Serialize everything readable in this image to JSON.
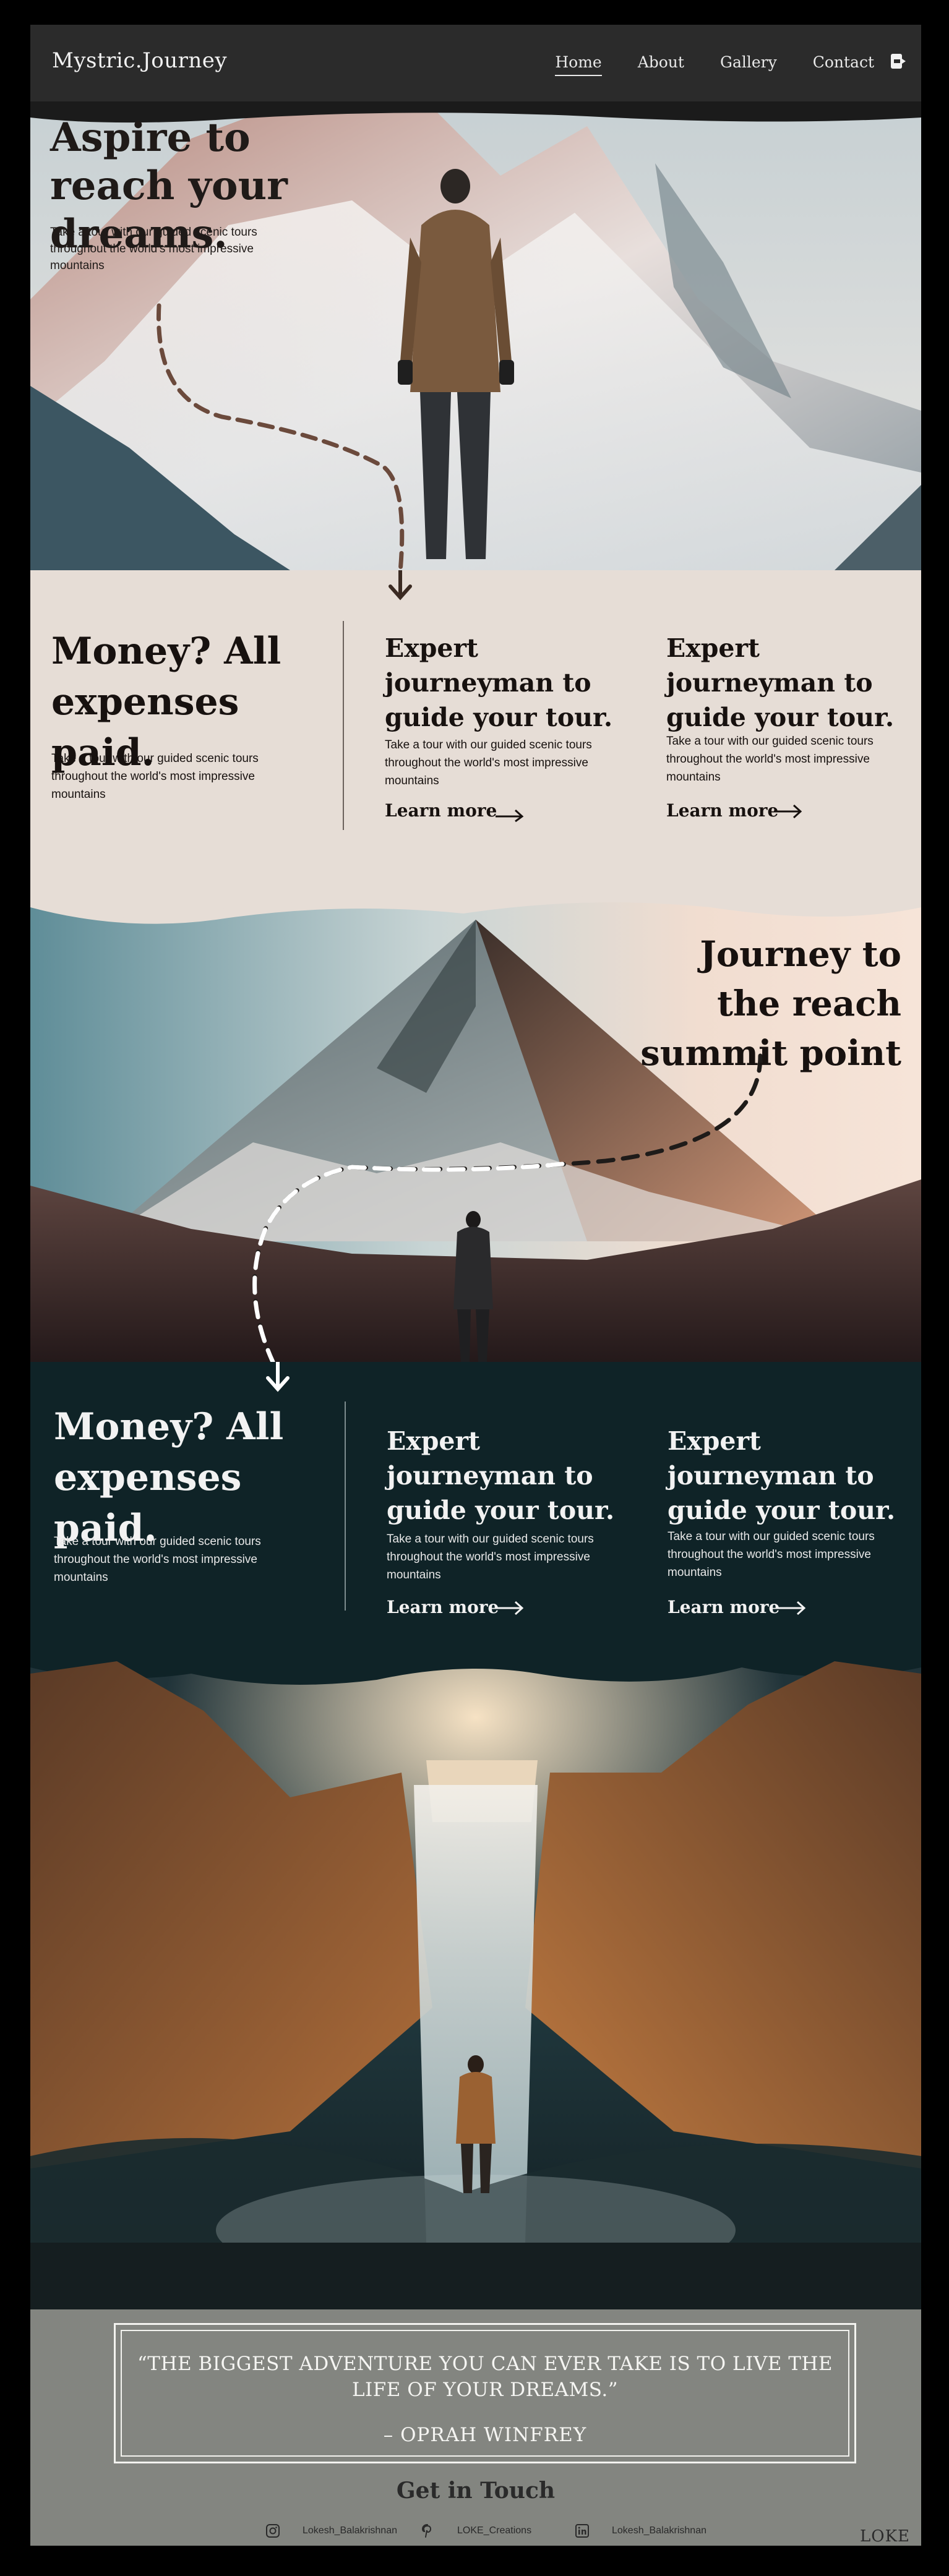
{
  "nav": {
    "brand": "Mystric.Journey",
    "links": [
      "Home",
      "About",
      "Gallery",
      "Contact"
    ],
    "active_link": "Home",
    "icon": "logout-icon"
  },
  "hero": {
    "title": "Aspire to reach your dreams.",
    "subtitle": "Take a tour with our guided scenic tours throughout the world's most impressive mountains"
  },
  "section_light": {
    "main_title": "Money? All expenses paid.",
    "main_text": "Take a tour with our guided scenic tours throughout the world's most impressive mountains",
    "features": [
      {
        "title": "Expert journeyman to guide your tour.",
        "text": "Take a tour with our guided scenic tours throughout the world's most impressive mountains",
        "link": "Learn more"
      },
      {
        "title": "Expert journeyman to guide your tour.",
        "text": "Take a tour with our guided scenic tours throughout the world's most impressive mountains",
        "link": "Learn more"
      }
    ]
  },
  "pyramid": {
    "title": "Journey to the reach summit point"
  },
  "section_dark": {
    "main_title": "Money? All expenses paid.",
    "main_text": "Take a tour with our guided scenic tours throughout the world's most impressive mountains",
    "features": [
      {
        "title": "Expert journeyman to guide your tour.",
        "text": "Take a tour with our guided scenic tours throughout the world's most impressive mountains",
        "link": "Learn more"
      },
      {
        "title": "Expert journeyman to guide your tour.",
        "text": "Take a tour with our guided scenic tours throughout the world's most impressive mountains",
        "link": "Learn more"
      }
    ]
  },
  "footer": {
    "quote": "“THE BIGGEST ADVENTURE YOU CAN EVER TAKE IS TO LIVE THE LIFE OF YOUR DREAMS.”",
    "author": "– OPRAH WINFREY",
    "get_in_touch": "Get in Touch",
    "socials": [
      {
        "icon": "instagram-icon",
        "label": "Lokesh_Balakrishnan"
      },
      {
        "icon": "pinterest-icon",
        "label": "LOKE_Creations"
      },
      {
        "icon": "linkedin-icon",
        "label": "Lokesh_Balakrishnan"
      }
    ],
    "logo": "LOKE"
  },
  "colors": {
    "nav_bg": "#2b2b2b",
    "light_band": "#e6ddd6",
    "dark_band": "#0f2327",
    "footer_bg": "#838580",
    "dark_text": "#1f1a18",
    "light_text": "#f2f2f2"
  }
}
